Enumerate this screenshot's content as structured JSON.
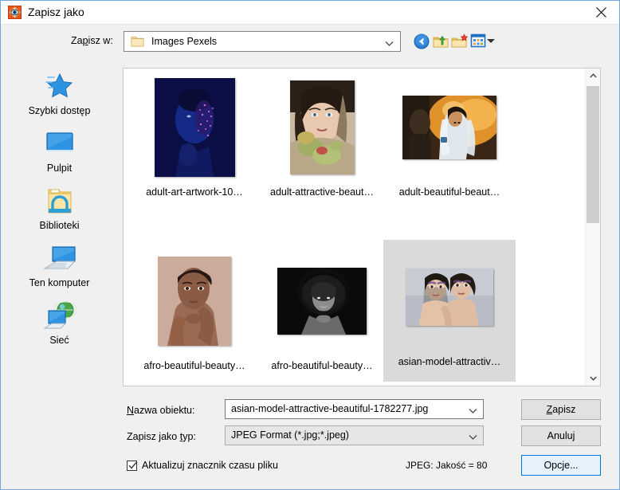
{
  "window": {
    "title": "Zapisz jako",
    "icon": "app-eye-icon",
    "close_label": "✕",
    "border_color": "#6fa8dc"
  },
  "toolbar": {
    "save_in_label": "Zapisz w:",
    "save_in_label_accesskey": "p",
    "current_folder": "Images Pexels",
    "folder_icon": "folder-icon",
    "chevron": "chevron-down-icon",
    "buttons": [
      {
        "name": "back-button",
        "icon": "back-arrow-icon",
        "tooltip": "Wstecz"
      },
      {
        "name": "up-folder-button",
        "icon": "up-folder-icon",
        "tooltip": "W górę"
      },
      {
        "name": "new-folder-button",
        "icon": "new-folder-icon",
        "tooltip": "Nowy folder"
      },
      {
        "name": "views-button",
        "icon": "views-icon",
        "tooltip": "Widoki"
      }
    ]
  },
  "places": {
    "items": [
      {
        "label": "Szybki dostęp",
        "icon": "star-icon"
      },
      {
        "label": "Pulpit",
        "icon": "monitor-icon"
      },
      {
        "label": "Biblioteki",
        "icon": "libraries-folder-icon"
      },
      {
        "label": "Ten komputer",
        "icon": "computer-icon"
      },
      {
        "label": "Sieć",
        "icon": "network-globe-icon"
      }
    ]
  },
  "file_list": {
    "selected_index": 5,
    "selection_color": "#dadada",
    "items": [
      {
        "label": "adult-art-artwork-10…",
        "thumb": "blue-bodypaint-portrait",
        "orientation": "portrait"
      },
      {
        "label": "adult-attractive-beaut…",
        "thumb": "woman-with-flowers-portrait",
        "orientation": "portrait"
      },
      {
        "label": "adult-beautiful-beaut…",
        "thumb": "bride-orange-bokeh",
        "orientation": "landscape"
      },
      {
        "label": "afro-beautiful-beauty…",
        "thumb": "dark-skinned-woman-portrait",
        "orientation": "portrait"
      },
      {
        "label": "afro-beautiful-beauty…",
        "thumb": "bw-afro-woman",
        "orientation": "landscape"
      },
      {
        "label": "asian-model-attractiv…",
        "thumb": "two-asian-models",
        "orientation": "landscape"
      }
    ]
  },
  "scrollbar": {
    "up_arrow": "chevron-up-icon",
    "down_arrow": "chevron-down-icon",
    "thumb_top_pct": 5,
    "thumb_height_pct": 43
  },
  "form": {
    "filename_label": "Nazwa obiektu:",
    "filename_label_accesskey": "N",
    "filename_value": "asian-model-attractive-beautiful-1782277.jpg",
    "filetype_label": "Zapisz jako typ:",
    "filetype_label_accesskey": "t",
    "filetype_value": "JPEG Format (*.jpg;*.jpeg)",
    "checkbox_label": "Aktualizuj znacznik czasu pliku",
    "checkbox_checked": true,
    "quality_text": "JPEG: Jakość = 80"
  },
  "buttons": {
    "save": "Zapisz",
    "save_accesskey": "Z",
    "cancel": "Anuluj",
    "options": "Opcje...",
    "focus_color": "#0078d7"
  }
}
